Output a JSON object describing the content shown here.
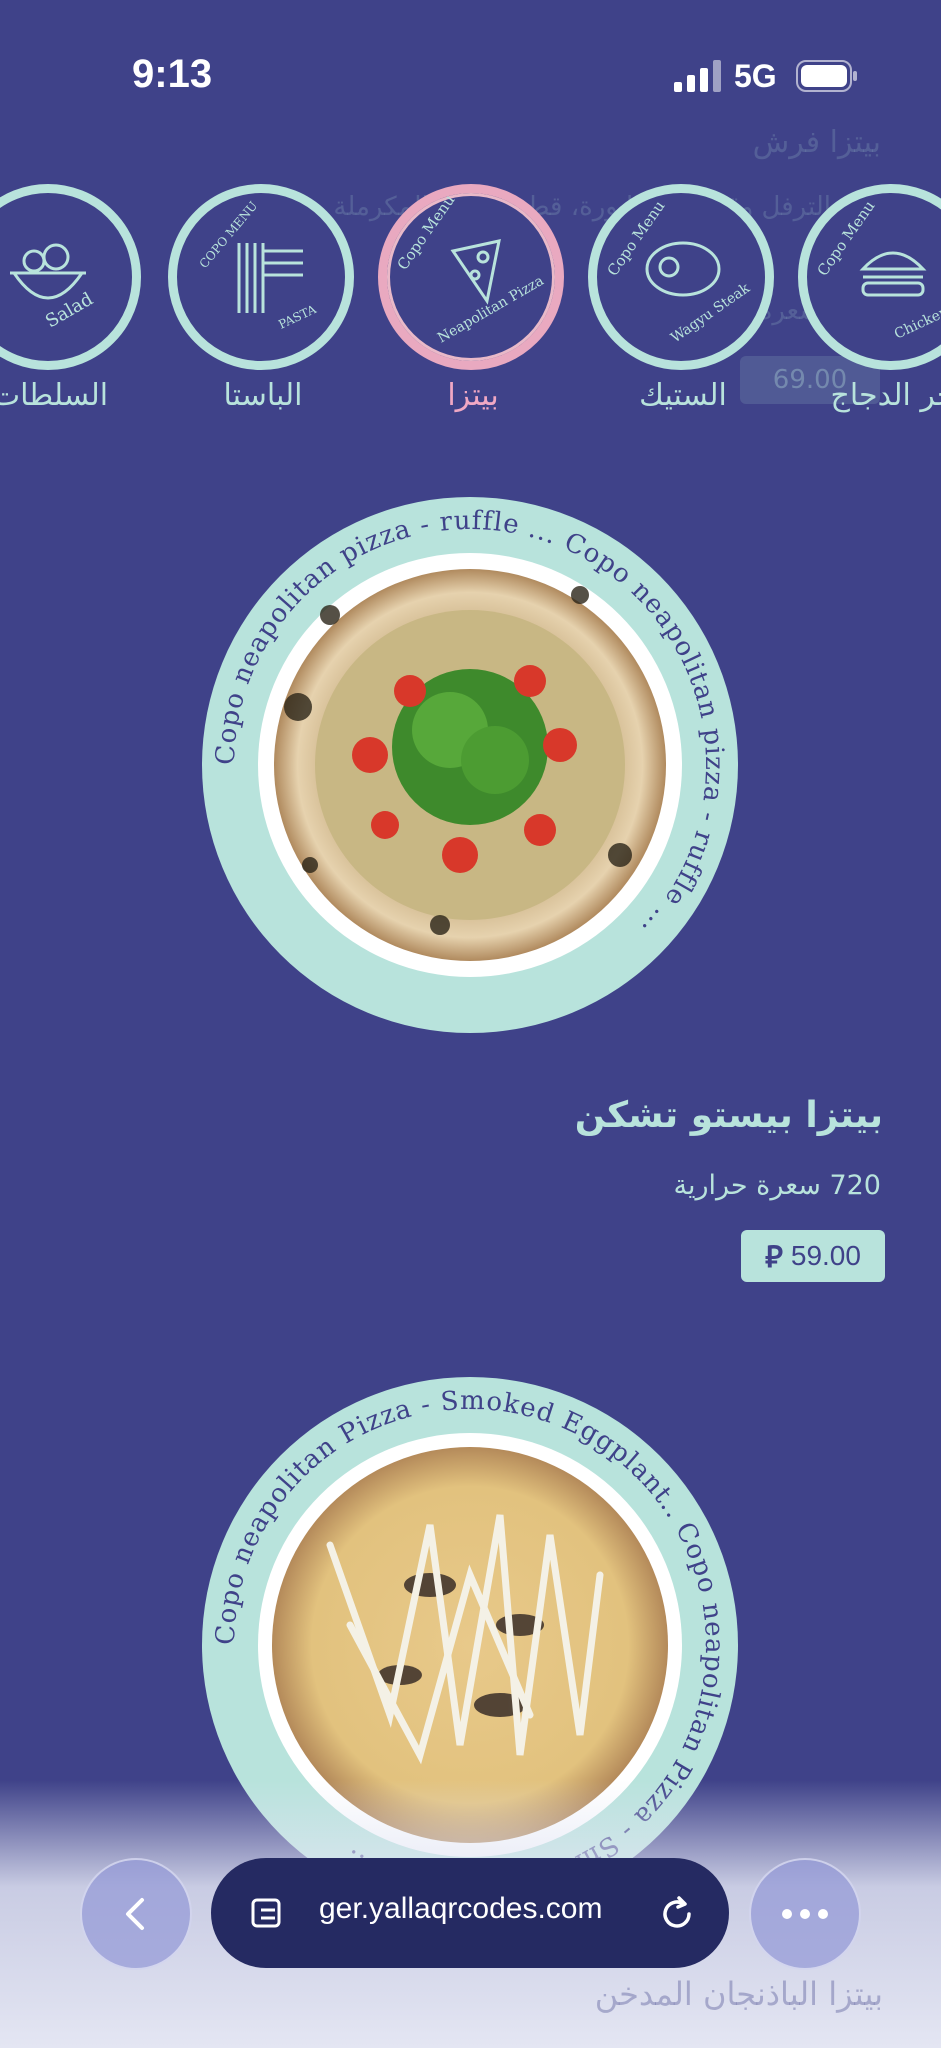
{
  "status_bar": {
    "time": "9:13",
    "network": "5G"
  },
  "ghost_header": {
    "line1": "بيتزا فرش",
    "line2": "الترفل وقطعة الشابورة، قطع الدجاج المكرملة",
    "line3": "سعرة",
    "price": "69.00"
  },
  "categories": [
    {
      "label": "السلطات",
      "icon_text": "Salad",
      "icon": "salad-bowl-icon",
      "active": false
    },
    {
      "label": "الباستا",
      "icon_text": "PASTA",
      "icon": "pasta-icon",
      "active": false
    },
    {
      "label": "بيتزا",
      "icon_text": "Neapolitan Pizza",
      "icon": "pizza-slice-icon",
      "active": true
    },
    {
      "label": "الستيك",
      "icon_text": "Wagyu Steak",
      "icon": "steak-icon",
      "active": false
    },
    {
      "label": "جر الدجاج",
      "icon_text": "Chicken",
      "icon": "burger-icon",
      "active": false
    }
  ],
  "category_brand": "Copo Menu",
  "products": [
    {
      "name": "بيتزا بيستو تشكن",
      "calories": "720 سعرة حرارية",
      "price": "59.00",
      "plate_text": "Copo neapolitan pizza - ruffle ... Copo neapolitan pizza - ruffle ... "
    },
    {
      "name": "بيتزا الباذنجان المدخن",
      "plate_text": "Copo neapolitan Pizza - Smoked Eggplant.. Copo neapolitan Pizza - Smoked Eggplant .. "
    }
  ],
  "browser": {
    "url": "ger.yallaqrcodes.com"
  },
  "colors": {
    "background": "#3f4289",
    "accent": "#b8e3dc",
    "active": "#f0a8c4"
  }
}
